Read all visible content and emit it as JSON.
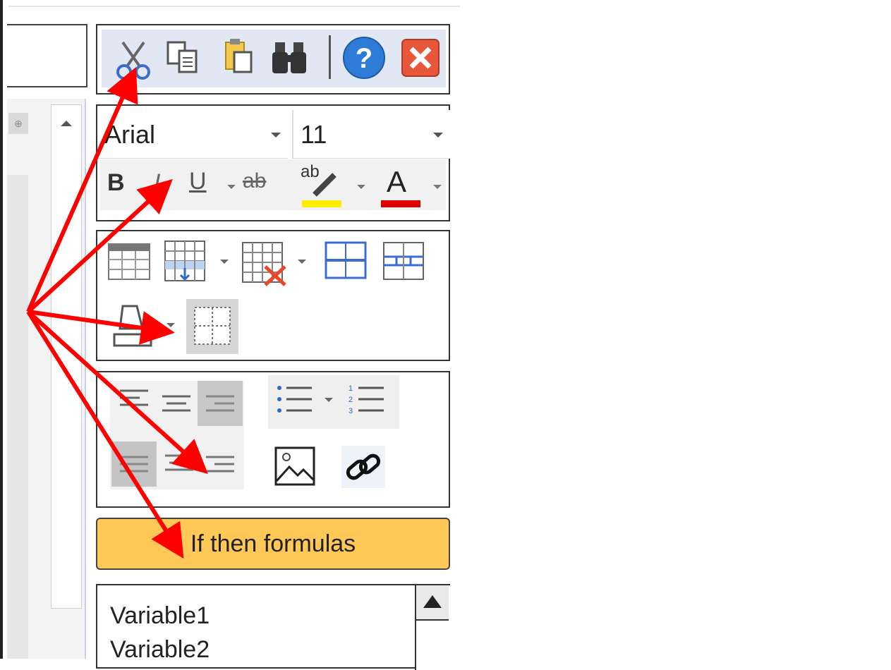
{
  "font": {
    "family": "Arial",
    "size": "11"
  },
  "format": {
    "bold": "B",
    "italic": "I",
    "underline": "U",
    "strike": "ab",
    "highlight": "ab",
    "font_color": "A"
  },
  "button": {
    "if_then": "If then formulas"
  },
  "variables": [
    "Variable1",
    "Variable2"
  ],
  "colors": {
    "annotation": "#ff0000",
    "button_bg": "#ffc857",
    "highlight_bar": "#ffee00",
    "font_color_bar": "#e00000",
    "toolbar_strip": "#e2e8f3"
  },
  "icons": [
    "cut-icon",
    "copy-icon",
    "paste-icon",
    "find-icon",
    "help-icon",
    "close-icon",
    "table-icon",
    "insert-row-icon",
    "delete-table-icon",
    "insert-row-below-icon",
    "split-cells-icon",
    "shading-icon",
    "borders-icon",
    "align-left-icon",
    "align-center-icon",
    "align-right-icon",
    "justify-icon",
    "bullet-list-icon",
    "numbered-list-icon",
    "image-icon",
    "link-icon"
  ]
}
